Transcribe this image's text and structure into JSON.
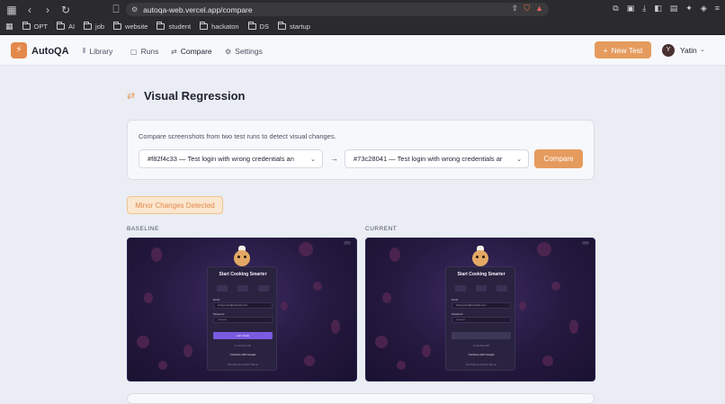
{
  "browser": {
    "url": "autoqa-web.vercel.app/compare",
    "bookmarks": [
      "OPT",
      "AI",
      "job",
      "website",
      "student",
      "hackaton",
      "DS",
      "startup"
    ]
  },
  "app": {
    "brand": "AutoQA",
    "nav": [
      {
        "label": "Library",
        "icon": "library-icon"
      },
      {
        "label": "Runs",
        "icon": "clipboard-icon"
      },
      {
        "label": "Compare",
        "icon": "compare-icon"
      },
      {
        "label": "Settings",
        "icon": "gear-icon"
      }
    ],
    "new_test_label": "New Test",
    "user": {
      "initial": "Y",
      "name": "Yatin"
    }
  },
  "page": {
    "title": "Visual Regression",
    "description": "Compare screenshots from two test runs to detect visual changes.",
    "baseline_select": "#f82f4c33 — Test login with wrong credentials an",
    "current_select": "#73c28041 — Test login with wrong credentials ar",
    "compare_label": "Compare",
    "status_badge": "Minor Changes Detected",
    "baseline_caption": "BASELINE",
    "current_caption": "CURRENT"
  },
  "preview": {
    "title": "Start Cooking Smarter",
    "email_label": "Email",
    "email_value": "wrong.user@example.com",
    "password_label": "Password",
    "login_label": "Let's Cook",
    "or_text": "or continue with",
    "google_label": "Continue with Google",
    "footer": "Don't have an account? Sign up"
  },
  "colors": {
    "accent": "#e59b5e",
    "badge_bg": "#fbe6cf",
    "badge_text": "#e2894b",
    "login_button": "#7a5be0"
  }
}
